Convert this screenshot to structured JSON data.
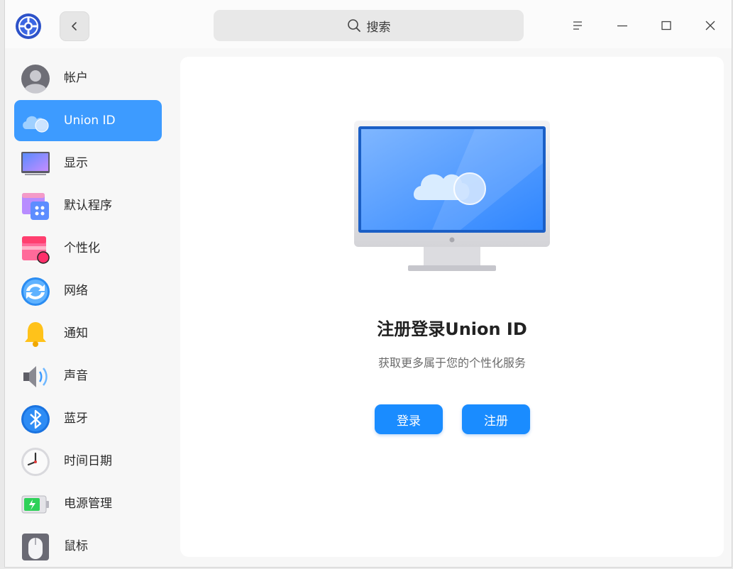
{
  "titlebar": {
    "app_icon": "control-center-gear-icon",
    "back_icon": "chevron-left-icon",
    "search_placeholder": "搜索",
    "menu_icon": "hamburger-menu-icon",
    "minimize_icon": "minimize-icon",
    "maximize_icon": "maximize-icon",
    "close_icon": "close-icon"
  },
  "sidebar": {
    "items": [
      {
        "label": "帐户",
        "icon": "account-avatar-icon",
        "active": false
      },
      {
        "label": "Union ID",
        "icon": "cloud-icon",
        "active": true
      },
      {
        "label": "显示",
        "icon": "display-icon",
        "active": false
      },
      {
        "label": "默认程序",
        "icon": "default-apps-icon",
        "active": false
      },
      {
        "label": "个性化",
        "icon": "personalization-icon",
        "active": false
      },
      {
        "label": "网络",
        "icon": "network-icon",
        "active": false
      },
      {
        "label": "通知",
        "icon": "bell-icon",
        "active": false
      },
      {
        "label": "声音",
        "icon": "speaker-icon",
        "active": false
      },
      {
        "label": "蓝牙",
        "icon": "bluetooth-icon",
        "active": false
      },
      {
        "label": "时间日期",
        "icon": "clock-icon",
        "active": false
      },
      {
        "label": "电源管理",
        "icon": "battery-icon",
        "active": false
      },
      {
        "label": "鼠标",
        "icon": "mouse-icon",
        "active": false
      }
    ]
  },
  "main": {
    "illustration": "monitor-cloud-illustration",
    "title": "注册登录Union ID",
    "subtitle": "获取更多属于您的个性化服务",
    "login_label": "登录",
    "register_label": "注册"
  },
  "colors": {
    "accent": "#1a8cff",
    "active_item": "#3d9bff",
    "panel_bg": "#ffffff",
    "window_bg": "#f7f7f7"
  }
}
